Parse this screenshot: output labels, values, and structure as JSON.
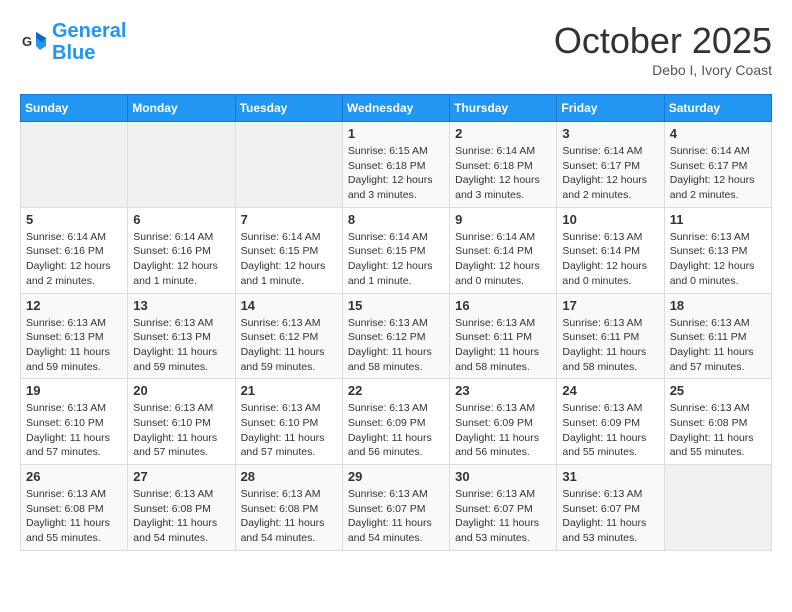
{
  "header": {
    "logo_line1": "General",
    "logo_line2": "Blue",
    "month_title": "October 2025",
    "location": "Debo I, Ivory Coast"
  },
  "days_of_week": [
    "Sunday",
    "Monday",
    "Tuesday",
    "Wednesday",
    "Thursday",
    "Friday",
    "Saturday"
  ],
  "weeks": [
    [
      {
        "num": "",
        "info": ""
      },
      {
        "num": "",
        "info": ""
      },
      {
        "num": "",
        "info": ""
      },
      {
        "num": "1",
        "info": "Sunrise: 6:15 AM\nSunset: 6:18 PM\nDaylight: 12 hours and 3 minutes."
      },
      {
        "num": "2",
        "info": "Sunrise: 6:14 AM\nSunset: 6:18 PM\nDaylight: 12 hours and 3 minutes."
      },
      {
        "num": "3",
        "info": "Sunrise: 6:14 AM\nSunset: 6:17 PM\nDaylight: 12 hours and 2 minutes."
      },
      {
        "num": "4",
        "info": "Sunrise: 6:14 AM\nSunset: 6:17 PM\nDaylight: 12 hours and 2 minutes."
      }
    ],
    [
      {
        "num": "5",
        "info": "Sunrise: 6:14 AM\nSunset: 6:16 PM\nDaylight: 12 hours and 2 minutes."
      },
      {
        "num": "6",
        "info": "Sunrise: 6:14 AM\nSunset: 6:16 PM\nDaylight: 12 hours and 1 minute."
      },
      {
        "num": "7",
        "info": "Sunrise: 6:14 AM\nSunset: 6:15 PM\nDaylight: 12 hours and 1 minute."
      },
      {
        "num": "8",
        "info": "Sunrise: 6:14 AM\nSunset: 6:15 PM\nDaylight: 12 hours and 1 minute."
      },
      {
        "num": "9",
        "info": "Sunrise: 6:14 AM\nSunset: 6:14 PM\nDaylight: 12 hours and 0 minutes."
      },
      {
        "num": "10",
        "info": "Sunrise: 6:13 AM\nSunset: 6:14 PM\nDaylight: 12 hours and 0 minutes."
      },
      {
        "num": "11",
        "info": "Sunrise: 6:13 AM\nSunset: 6:13 PM\nDaylight: 12 hours and 0 minutes."
      }
    ],
    [
      {
        "num": "12",
        "info": "Sunrise: 6:13 AM\nSunset: 6:13 PM\nDaylight: 11 hours and 59 minutes."
      },
      {
        "num": "13",
        "info": "Sunrise: 6:13 AM\nSunset: 6:13 PM\nDaylight: 11 hours and 59 minutes."
      },
      {
        "num": "14",
        "info": "Sunrise: 6:13 AM\nSunset: 6:12 PM\nDaylight: 11 hours and 59 minutes."
      },
      {
        "num": "15",
        "info": "Sunrise: 6:13 AM\nSunset: 6:12 PM\nDaylight: 11 hours and 58 minutes."
      },
      {
        "num": "16",
        "info": "Sunrise: 6:13 AM\nSunset: 6:11 PM\nDaylight: 11 hours and 58 minutes."
      },
      {
        "num": "17",
        "info": "Sunrise: 6:13 AM\nSunset: 6:11 PM\nDaylight: 11 hours and 58 minutes."
      },
      {
        "num": "18",
        "info": "Sunrise: 6:13 AM\nSunset: 6:11 PM\nDaylight: 11 hours and 57 minutes."
      }
    ],
    [
      {
        "num": "19",
        "info": "Sunrise: 6:13 AM\nSunset: 6:10 PM\nDaylight: 11 hours and 57 minutes."
      },
      {
        "num": "20",
        "info": "Sunrise: 6:13 AM\nSunset: 6:10 PM\nDaylight: 11 hours and 57 minutes."
      },
      {
        "num": "21",
        "info": "Sunrise: 6:13 AM\nSunset: 6:10 PM\nDaylight: 11 hours and 57 minutes."
      },
      {
        "num": "22",
        "info": "Sunrise: 6:13 AM\nSunset: 6:09 PM\nDaylight: 11 hours and 56 minutes."
      },
      {
        "num": "23",
        "info": "Sunrise: 6:13 AM\nSunset: 6:09 PM\nDaylight: 11 hours and 56 minutes."
      },
      {
        "num": "24",
        "info": "Sunrise: 6:13 AM\nSunset: 6:09 PM\nDaylight: 11 hours and 55 minutes."
      },
      {
        "num": "25",
        "info": "Sunrise: 6:13 AM\nSunset: 6:08 PM\nDaylight: 11 hours and 55 minutes."
      }
    ],
    [
      {
        "num": "26",
        "info": "Sunrise: 6:13 AM\nSunset: 6:08 PM\nDaylight: 11 hours and 55 minutes."
      },
      {
        "num": "27",
        "info": "Sunrise: 6:13 AM\nSunset: 6:08 PM\nDaylight: 11 hours and 54 minutes."
      },
      {
        "num": "28",
        "info": "Sunrise: 6:13 AM\nSunset: 6:08 PM\nDaylight: 11 hours and 54 minutes."
      },
      {
        "num": "29",
        "info": "Sunrise: 6:13 AM\nSunset: 6:07 PM\nDaylight: 11 hours and 54 minutes."
      },
      {
        "num": "30",
        "info": "Sunrise: 6:13 AM\nSunset: 6:07 PM\nDaylight: 11 hours and 53 minutes."
      },
      {
        "num": "31",
        "info": "Sunrise: 6:13 AM\nSunset: 6:07 PM\nDaylight: 11 hours and 53 minutes."
      },
      {
        "num": "",
        "info": ""
      }
    ]
  ]
}
